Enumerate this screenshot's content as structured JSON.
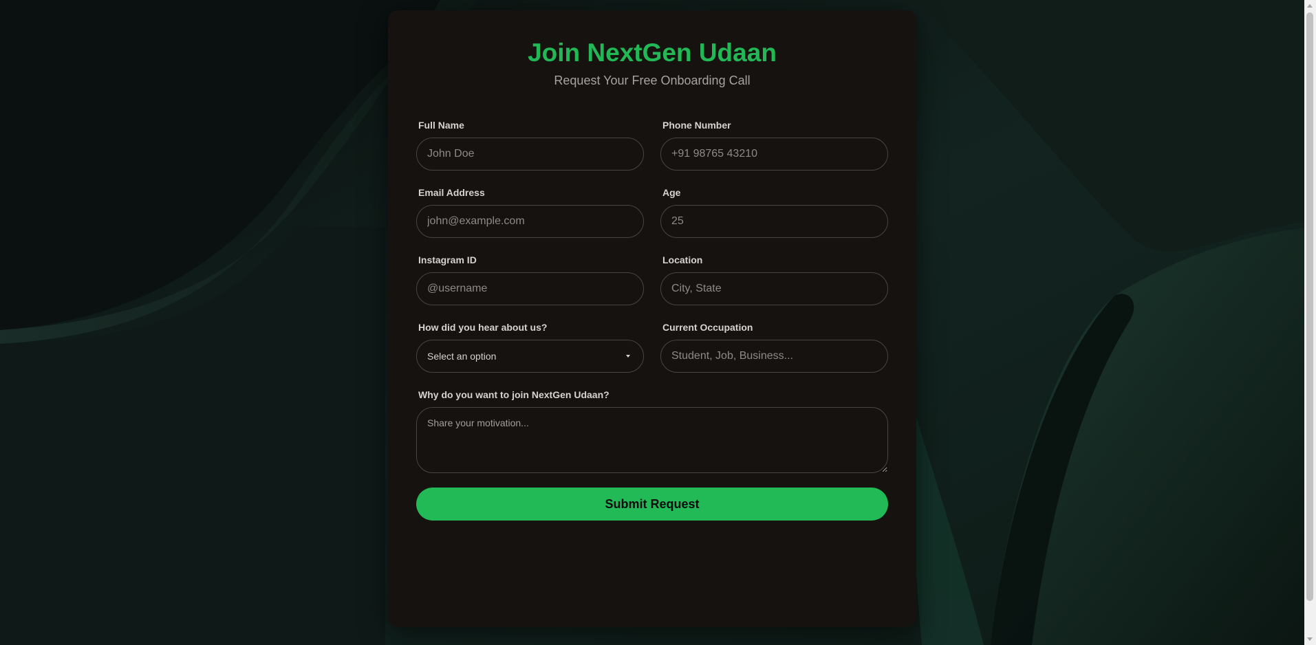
{
  "header": {
    "title": "Join NextGen Udaan",
    "subtitle": "Request Your Free Onboarding Call"
  },
  "form": {
    "full_name": {
      "label": "Full Name",
      "placeholder": "John Doe"
    },
    "phone": {
      "label": "Phone Number",
      "placeholder": "+91 98765 43210"
    },
    "email": {
      "label": "Email Address",
      "placeholder": "john@example.com"
    },
    "age": {
      "label": "Age",
      "placeholder": "25"
    },
    "instagram": {
      "label": "Instagram ID",
      "placeholder": "@username"
    },
    "location": {
      "label": "Location",
      "placeholder": "City, State"
    },
    "source": {
      "label": "How did you hear about us?",
      "selected": "Select an option"
    },
    "occupation": {
      "label": "Current Occupation",
      "placeholder": "Student, Job, Business..."
    },
    "motivation": {
      "label": "Why do you want to join NextGen Udaan?",
      "placeholder": "Share your motivation..."
    },
    "submit_label": "Submit Request"
  },
  "colors": {
    "accent": "#22b856",
    "card_background": "#161210",
    "page_background": "#0b1210"
  },
  "icons": {
    "dropdown": "chevron-down-icon"
  }
}
